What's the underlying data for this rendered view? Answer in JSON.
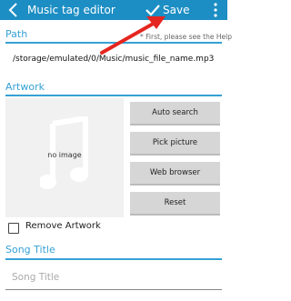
{
  "app": {
    "title": "Music tag editor",
    "save_label": "Save",
    "accent": "#1c8ec4"
  },
  "path_section": {
    "heading": "Path",
    "note": "* First, please see the Help",
    "value": "/storage/emulated/0/Music/music_file_name.mp3"
  },
  "artwork": {
    "heading": "Artwork",
    "placeholder_text": "no image",
    "buttons": [
      "Auto search",
      "Pick picture",
      "Web browser",
      "Reset"
    ],
    "remove_label": "Remove Artwork"
  },
  "song_title": {
    "heading": "Song Title",
    "placeholder": "Song Title"
  }
}
